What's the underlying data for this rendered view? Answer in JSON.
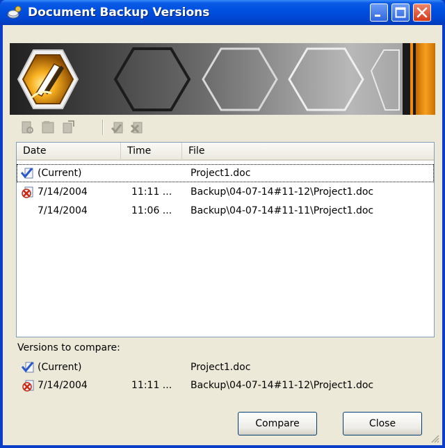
{
  "window": {
    "title": "Document Backup Versions",
    "icon": "backup-app-icon",
    "controls": {
      "minimize": "minimize-icon",
      "maximize": "maximize-icon",
      "close": "close-icon"
    }
  },
  "banner": {
    "logo": "pen-hexagon-logo"
  },
  "toolbar": {
    "icons": [
      "view-document-icon",
      "open-document-icon",
      "restore-document-icon",
      "mark-compare-icon",
      "unmark-compare-icon"
    ]
  },
  "list": {
    "columns": [
      "Date",
      "Time",
      "File"
    ],
    "rows": [
      {
        "date": "(Current)",
        "time": "",
        "file": "Project1.doc",
        "icon": "current-check-icon"
      },
      {
        "date": "7/14/2004",
        "time": "11:11 ...",
        "file": "Backup\\04-07-14#11-12\\Project1.doc",
        "icon": "compare-mark-icon"
      },
      {
        "date": "7/14/2004",
        "time": "11:06 ...",
        "file": "Backup\\04-07-14#11-11\\Project1.doc",
        "icon": ""
      }
    ]
  },
  "compare": {
    "label": "Versions to compare:",
    "rows": [
      {
        "date": "(Current)",
        "time": "",
        "file": "Project1.doc",
        "icon": "current-check-icon"
      },
      {
        "date": "7/14/2004",
        "time": "11:11 ...",
        "file": "Backup\\04-07-14#11-12\\Project1.doc",
        "icon": "compare-mark-icon"
      }
    ]
  },
  "buttons": {
    "compare": "Compare",
    "close": "Close"
  },
  "colors": {
    "titlebar": "#0050e0",
    "frame": "#0a3ec8",
    "client": "#ece9d8",
    "banner_accent": "#f08c10"
  }
}
